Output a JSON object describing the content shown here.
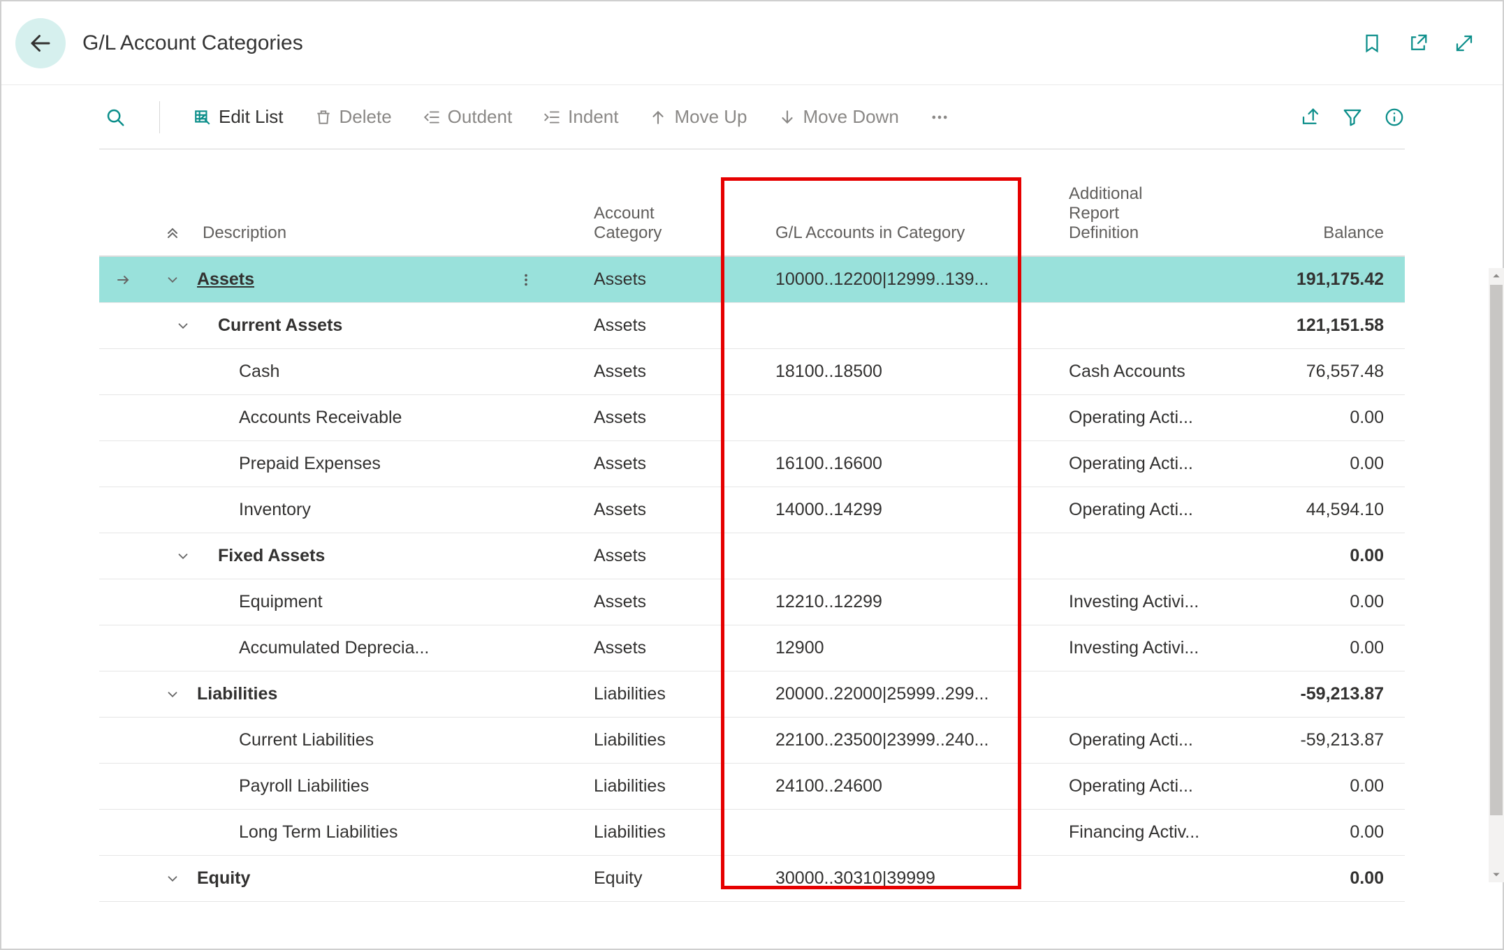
{
  "title": "G/L Account Categories",
  "toolbar": {
    "edit_list": "Edit List",
    "delete": "Delete",
    "outdent": "Outdent",
    "indent": "Indent",
    "move_up": "Move Up",
    "move_down": "Move Down"
  },
  "columns": {
    "description": "Description",
    "account_category": "Account\nCategory",
    "gl_accounts": "G/L Accounts in Category",
    "additional_def": "Additional\nReport\nDefinition",
    "balance": "Balance"
  },
  "rows": [
    {
      "indent": 0,
      "bold": true,
      "selected": true,
      "chevron": "down",
      "arrow": true,
      "description": "Assets",
      "category": "Assets",
      "gl": "10000..12200|12999..139...",
      "def": "",
      "balance": "191,175.42"
    },
    {
      "indent": 1,
      "bold": true,
      "selected": false,
      "chevron": "down",
      "arrow": false,
      "description": "Current Assets",
      "category": "Assets",
      "gl": "",
      "def": "",
      "balance": "121,151.58"
    },
    {
      "indent": 2,
      "bold": false,
      "selected": false,
      "chevron": "",
      "arrow": false,
      "description": "Cash",
      "category": "Assets",
      "gl": "18100..18500",
      "def": "Cash Accounts",
      "balance": "76,557.48"
    },
    {
      "indent": 2,
      "bold": false,
      "selected": false,
      "chevron": "",
      "arrow": false,
      "description": "Accounts Receivable",
      "category": "Assets",
      "gl": "",
      "def": "Operating Acti...",
      "balance": "0.00"
    },
    {
      "indent": 2,
      "bold": false,
      "selected": false,
      "chevron": "",
      "arrow": false,
      "description": "Prepaid Expenses",
      "category": "Assets",
      "gl": "16100..16600",
      "def": "Operating Acti...",
      "balance": "0.00"
    },
    {
      "indent": 2,
      "bold": false,
      "selected": false,
      "chevron": "",
      "arrow": false,
      "description": "Inventory",
      "category": "Assets",
      "gl": "14000..14299",
      "def": "Operating Acti...",
      "balance": "44,594.10"
    },
    {
      "indent": 1,
      "bold": true,
      "selected": false,
      "chevron": "down",
      "arrow": false,
      "description": "Fixed Assets",
      "category": "Assets",
      "gl": "",
      "def": "",
      "balance": "0.00"
    },
    {
      "indent": 2,
      "bold": false,
      "selected": false,
      "chevron": "",
      "arrow": false,
      "description": "Equipment",
      "category": "Assets",
      "gl": "12210..12299",
      "def": "Investing Activi...",
      "balance": "0.00"
    },
    {
      "indent": 2,
      "bold": false,
      "selected": false,
      "chevron": "",
      "arrow": false,
      "description": "Accumulated Deprecia...",
      "category": "Assets",
      "gl": "12900",
      "def": "Investing Activi...",
      "balance": "0.00"
    },
    {
      "indent": 0,
      "bold": true,
      "selected": false,
      "chevron": "down",
      "arrow": false,
      "description": "Liabilities",
      "category": "Liabilities",
      "gl": "20000..22000|25999..299...",
      "def": "",
      "balance": "-59,213.87"
    },
    {
      "indent": 2,
      "bold": false,
      "selected": false,
      "chevron": "",
      "arrow": false,
      "description": "Current Liabilities",
      "category": "Liabilities",
      "gl": "22100..23500|23999..240...",
      "def": "Operating Acti...",
      "balance": "-59,213.87"
    },
    {
      "indent": 2,
      "bold": false,
      "selected": false,
      "chevron": "",
      "arrow": false,
      "description": "Payroll Liabilities",
      "category": "Liabilities",
      "gl": "24100..24600",
      "def": "Operating Acti...",
      "balance": "0.00"
    },
    {
      "indent": 2,
      "bold": false,
      "selected": false,
      "chevron": "",
      "arrow": false,
      "description": "Long Term Liabilities",
      "category": "Liabilities",
      "gl": "",
      "def": "Financing Activ...",
      "balance": "0.00"
    },
    {
      "indent": 0,
      "bold": true,
      "selected": false,
      "chevron": "down",
      "arrow": false,
      "description": "Equity",
      "category": "Equity",
      "gl": "30000..30310|39999",
      "def": "",
      "balance": "0.00"
    }
  ],
  "colors": {
    "accent": "#0b8e8a",
    "selection": "#99e1db",
    "annotation": "#e60000"
  }
}
